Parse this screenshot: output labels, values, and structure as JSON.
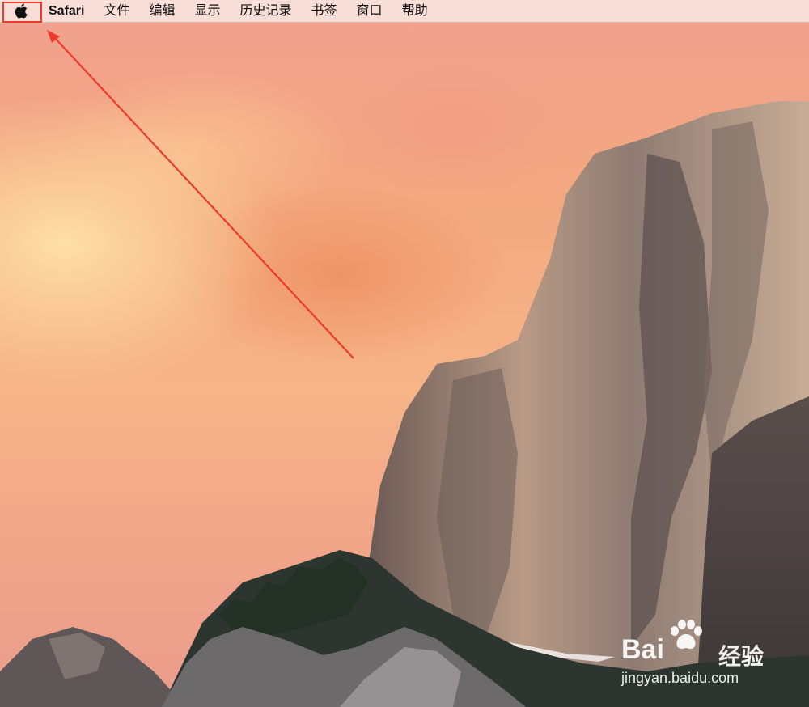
{
  "menubar": {
    "apple_icon": "apple-logo-icon",
    "app_name": "Safari",
    "items": [
      {
        "label": "文件"
      },
      {
        "label": "编辑"
      },
      {
        "label": "显示"
      },
      {
        "label": "历史记录"
      },
      {
        "label": "书签"
      },
      {
        "label": "窗口"
      },
      {
        "label": "帮助"
      }
    ]
  },
  "annotation": {
    "color": "#ee3a2a"
  },
  "watermark": {
    "brand": "Bai",
    "brand_cn": "经验",
    "url": "jingyan.baidu.com"
  }
}
